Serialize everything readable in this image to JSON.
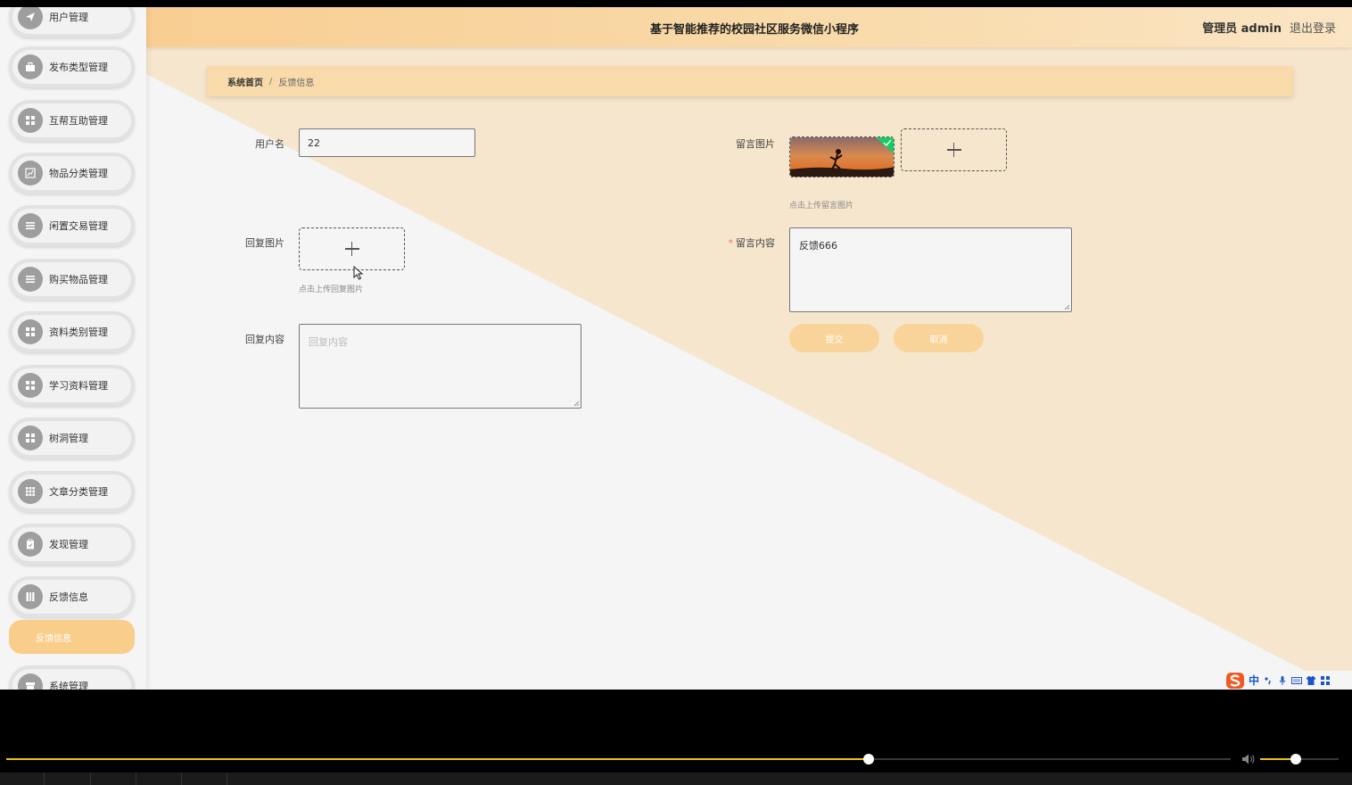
{
  "header": {
    "title": "基于智能推荐的校园社区服务微信小程序",
    "user": "管理员 admin",
    "logout": "退出登录"
  },
  "sidebar": {
    "items": [
      {
        "label": "用户管理",
        "icon": "send-icon"
      },
      {
        "label": "发布类型管理",
        "icon": "briefcase-icon"
      },
      {
        "label": "互帮互助管理",
        "icon": "grid-icon"
      },
      {
        "label": "物品分类管理",
        "icon": "chart-icon"
      },
      {
        "label": "闲置交易管理",
        "icon": "list-icon"
      },
      {
        "label": "购买物品管理",
        "icon": "list-icon"
      },
      {
        "label": "资料类别管理",
        "icon": "grid-icon"
      },
      {
        "label": "学习资料管理",
        "icon": "grid-icon"
      },
      {
        "label": "树洞管理",
        "icon": "grid-icon"
      },
      {
        "label": "文章分类管理",
        "icon": "table-icon"
      },
      {
        "label": "发现管理",
        "icon": "clipboard-icon"
      },
      {
        "label": "反馈信息",
        "icon": "book-icon"
      }
    ],
    "active_sub": "反馈信息",
    "last_item": {
      "label": "系统管理",
      "icon": "box-icon"
    }
  },
  "breadcrumb": {
    "home": "系统首页",
    "separator": "/",
    "current": "反馈信息"
  },
  "form": {
    "username_label": "用户名",
    "username_value": "22",
    "msg_image_label": "留言图片",
    "msg_image_hint": "点击上传留言图片",
    "reply_image_label": "回复图片",
    "reply_image_hint": "点击上传回复图片",
    "msg_content_label": "留言内容",
    "msg_content_required": "*",
    "msg_content_value": "反馈666",
    "reply_content_label": "回复内容",
    "reply_content_placeholder": "回复内容",
    "submit_label": "提交",
    "cancel_label": "取消"
  },
  "ime": {
    "mode": "中"
  },
  "player": {
    "progress_fraction": 0.704,
    "volume_fraction": 0.45
  },
  "colors": {
    "accent": "#f9cd8a",
    "header_start": "#f8ce92",
    "header_end": "#fae5c4",
    "progress": "#e8c31e",
    "success_badge": "#13ce66"
  }
}
